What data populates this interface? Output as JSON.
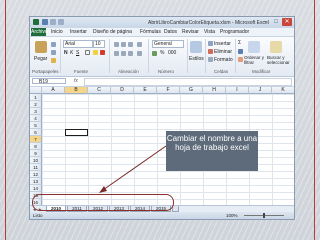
{
  "window": {
    "title": "AbrirLibroCambiarColorEtiqueta.xlsm - Microsoft Excel",
    "controls": {
      "minimize": "–",
      "maximize": "□",
      "close": "✕"
    }
  },
  "menu": {
    "tabs": [
      "Archivo",
      "Inicio",
      "Insertar",
      "Diseño de página",
      "Fórmulas",
      "Datos",
      "Revisar",
      "Vista",
      "Programador"
    ]
  },
  "ribbon": {
    "paste_label": "Pegar",
    "font_name": "Arial",
    "font_size": "10",
    "number_format": "General",
    "insert_label": "Insertar",
    "delete_label": "Eliminar",
    "format_label": "Formato",
    "styles_label": "Estilos",
    "sort_label": "Ordenar y filtrar",
    "find_label": "Buscar y seleccionar",
    "groups": {
      "clipboard": "Portapapeles",
      "font": "Fuente",
      "alignment": "Alineación",
      "number": "Número",
      "cells": "Celdas",
      "modify": "Modificar"
    }
  },
  "formula_bar": {
    "name_box": "B19",
    "fx": "fx",
    "value": ""
  },
  "grid": {
    "columns": [
      "A",
      "B",
      "C",
      "D",
      "E",
      "F",
      "G",
      "H",
      "I",
      "J",
      "K"
    ],
    "rows": [
      "1",
      "2",
      "3",
      "4",
      "5",
      "6",
      "7",
      "8",
      "9",
      "10",
      "11",
      "12",
      "13",
      "14",
      "15",
      "16"
    ],
    "selected_column": "B",
    "selected_row": "7"
  },
  "callout": {
    "text": "Cambiar el nombre a una hoja de trabajo excel"
  },
  "sheet_tabs": {
    "nav": [
      "◄",
      "►"
    ],
    "tabs": [
      "2010",
      "2011",
      "2012",
      "2013",
      "2014",
      "2015"
    ],
    "active": "2010"
  },
  "status_bar": {
    "status": "Listo",
    "zoom": "100%"
  },
  "colors": {
    "accent": "#1f6e3a",
    "callout": "#5d6b7a",
    "highlight": "#8d2f2f"
  }
}
